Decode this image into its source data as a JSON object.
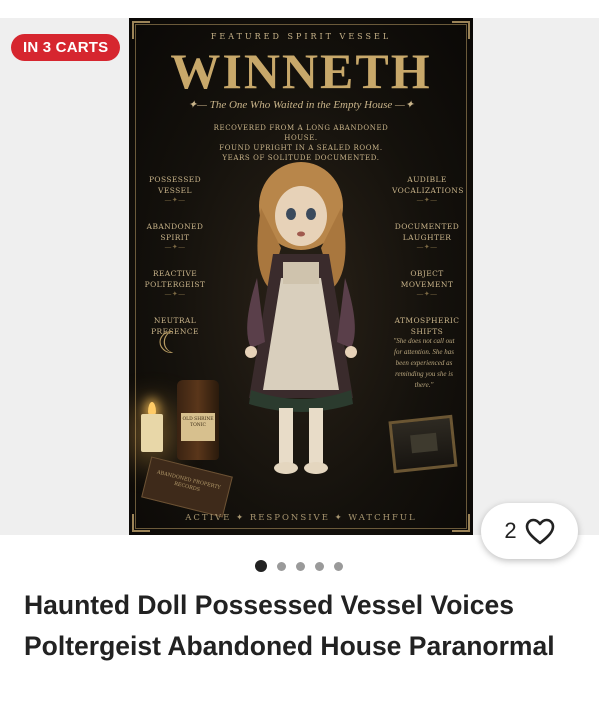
{
  "badge": {
    "cart_text": "IN 3 CARTS"
  },
  "poster": {
    "featured": "FEATURED SPIRIT VESSEL",
    "title": "WINNETH",
    "subtitle": "The One Who Waited in the Empty House",
    "description": [
      "RECOVERED FROM A LONG ABANDONED HOUSE.",
      "FOUND UPRIGHT IN A SEALED ROOM.",
      "YEARS OF SOLITUDE DOCUMENTED."
    ],
    "left_traits": [
      "POSSESSED VESSEL",
      "ABANDONED SPIRIT",
      "REACTIVE POLTERGEIST",
      "NEUTRAL PRESENCE"
    ],
    "right_traits": [
      "AUDIBLE VOCALIZATIONS",
      "DOCUMENTED LAUGHTER",
      "OBJECT MOVEMENT",
      "ATMOSPHERIC SHIFTS"
    ],
    "quote": "\"She does not call out for attention. She has been experienced as reminding you she is there.\"",
    "footer": "ACTIVE ✦ RESPONSIVE ✦ WATCHFUL",
    "bottle_label": "OLD SHRINE TONIC",
    "book_text": "ABANDONED PROPERTY RECORDS"
  },
  "favorite": {
    "count": "2",
    "icon": "heart-outline-icon"
  },
  "carousel": {
    "total": 5,
    "active_index": 0
  },
  "product": {
    "title": "Haunted Doll Possessed Vessel Voices Poltergeist Abandoned House Paranormal"
  },
  "colors": {
    "badge_red": "#d6262f",
    "poster_gold": "#c8a86a",
    "text_dark": "#222222"
  }
}
